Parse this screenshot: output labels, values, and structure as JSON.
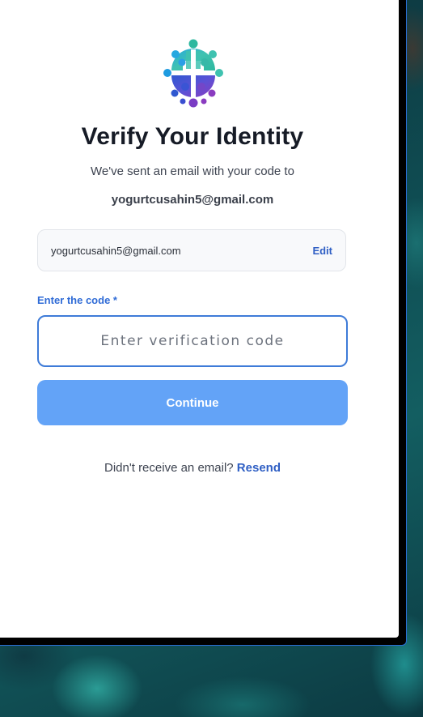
{
  "auth": {
    "logo_icon": "globe-people-logo-icon",
    "title": "Verify Your Identity",
    "subtitle": "We've sent an email with your code to",
    "email": "yogurtcusahin5@gmail.com",
    "email_box": {
      "value": "yogurtcusahin5@gmail.com",
      "edit_label": "Edit"
    },
    "code_field": {
      "label": "Enter the code *",
      "placeholder": "Enter verification code",
      "value": ""
    },
    "continue_label": "Continue",
    "resend": {
      "prompt": "Didn't receive an email?",
      "link_label": "Resend"
    }
  },
  "colors": {
    "accent": "#2f5fc4",
    "button": "#63a3f7",
    "input_border": "#3e7bd8",
    "title": "#161b26"
  }
}
